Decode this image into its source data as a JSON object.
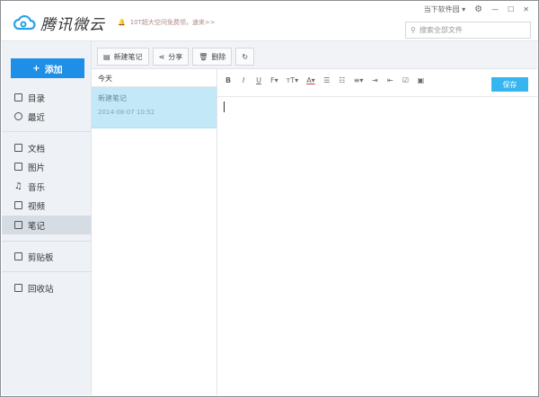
{
  "app": {
    "title": "腾讯微云",
    "notice": "10T超大空间免费领，速来>>",
    "source": "当下软件园",
    "search_placeholder": "搜索全部文件"
  },
  "sidebar": {
    "add_label": "添加",
    "items": [
      {
        "label": "目录"
      },
      {
        "label": "最近"
      },
      {
        "label": "文档"
      },
      {
        "label": "图片"
      },
      {
        "label": "音乐"
      },
      {
        "label": "视频"
      },
      {
        "label": "笔记"
      },
      {
        "label": "剪贴板"
      },
      {
        "label": "回收站"
      }
    ]
  },
  "toolbar": {
    "new_note": "新建笔记",
    "share": "分享",
    "delete": "删除"
  },
  "notes": {
    "group": "今天",
    "items": [
      {
        "title": "新建笔记",
        "date": "2014-08-07 10:52"
      }
    ]
  },
  "editor": {
    "save_label": "保存",
    "format": [
      "B",
      "I",
      "U",
      "F▾",
      "тT▾",
      "A▾",
      "☰",
      "☷",
      "≡▾",
      "⇥",
      "⇤",
      "☑",
      "▣"
    ]
  },
  "colors": {
    "accent": "#1e8ee6",
    "save": "#37b5ef",
    "selected_note": "#c3e8f8"
  }
}
